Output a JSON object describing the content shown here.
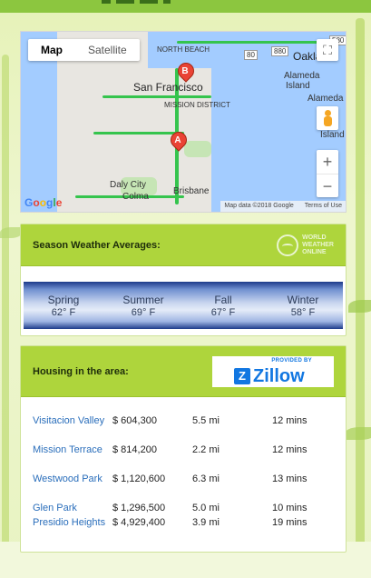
{
  "map": {
    "type_options": [
      "Map",
      "Satellite"
    ],
    "active_type": "Map",
    "labels": {
      "san_francisco": "San Francisco",
      "north_beach": "NORTH BEACH",
      "mission_district": "MISSION DISTRICT",
      "oakland": "Oakland",
      "alameda": "Alameda",
      "alameda_island": "Island",
      "alameda_label": "Alameda",
      "daly_city": "Daly City",
      "colma": "Colma",
      "brisbane": "Brisbane",
      "island": "Island",
      "highway_80": "80",
      "highway_580": "580",
      "highway_880": "880"
    },
    "markers": [
      "A",
      "B"
    ],
    "zoom_in": "+",
    "zoom_out": "−",
    "fullscreen_icon": "⛶",
    "logo": "Google",
    "footer": [
      "Map data ©2018 Google",
      "Terms of Use"
    ]
  },
  "weather": {
    "title": "Season Weather Averages:",
    "provider": [
      "WORLD",
      "WEATHER",
      "ONLINE"
    ],
    "seasons": [
      {
        "name": "Spring",
        "temp": "62° F"
      },
      {
        "name": "Summer",
        "temp": "69° F"
      },
      {
        "name": "Fall",
        "temp": "67° F"
      },
      {
        "name": "Winter",
        "temp": "58° F"
      }
    ]
  },
  "housing": {
    "title": "Housing in the area:",
    "provider_caption": "PROVIDED BY",
    "provider_name": "Zillow",
    "rows": [
      {
        "area": "Visitacion Valley",
        "price": "$ 604,300",
        "distance": "5.5 mi",
        "time": "12 mins"
      },
      {
        "area": "Mission Terrace",
        "price": "$ 814,200",
        "distance": "2.2 mi",
        "time": "12 mins"
      },
      {
        "area": "Westwood Park",
        "price": "$ 1,120,600",
        "distance": "6.3 mi",
        "time": "13 mins"
      },
      {
        "area": "Glen Park",
        "price": "$ 1,296,500",
        "distance": "5.0 mi",
        "time": "10 mins"
      },
      {
        "area": "Presidio Heights",
        "price": "$ 4,929,400",
        "distance": "3.9 mi",
        "time": "19 mins"
      }
    ]
  },
  "colors": {
    "accent": "#aed53c",
    "link": "#2a6ebb",
    "zillow": "#1277e1"
  }
}
